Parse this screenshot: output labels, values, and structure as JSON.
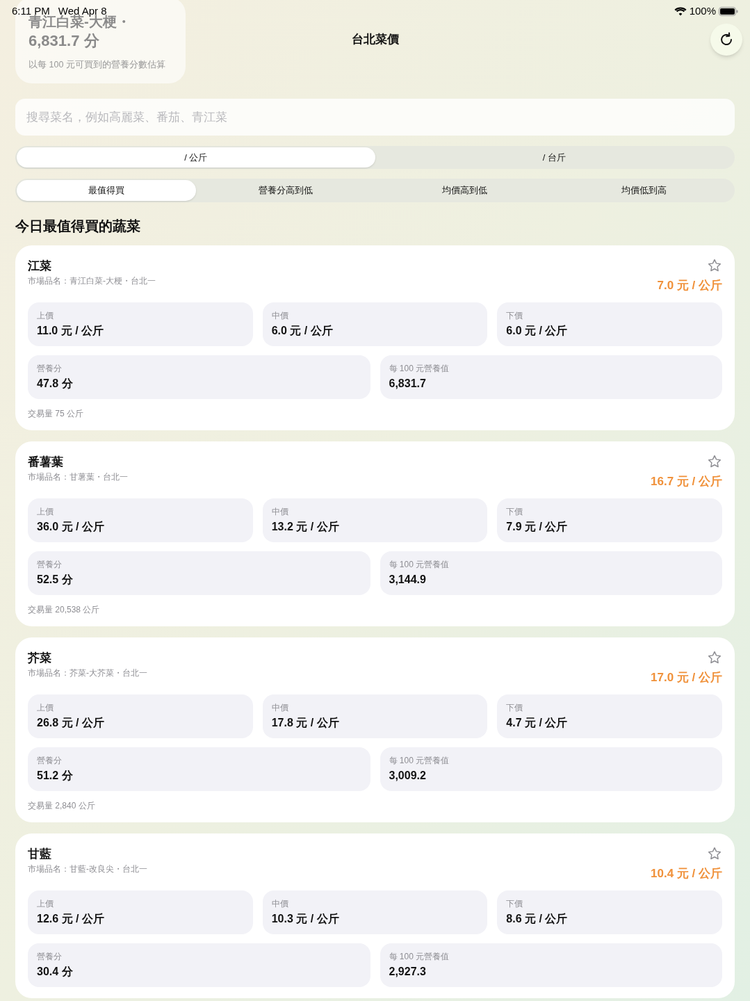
{
  "status_bar": {
    "time": "6:11 PM",
    "date": "Wed Apr 8",
    "battery": "100%"
  },
  "overlay_card": {
    "lines": [
      "青江白菜-大梗・",
      "6,831.7 分"
    ],
    "caption": "以每 100 元可買到的營養分數估算"
  },
  "header": {
    "title": "台北菜價"
  },
  "search": {
    "placeholder": "搜尋菜名，例如高麗菜、番茄、青江菜"
  },
  "unit_tabs": [
    {
      "label": "/ 公斤",
      "selected": true
    },
    {
      "label": "/ 台斤",
      "selected": false
    }
  ],
  "sort_tabs": [
    {
      "label": "最值得買",
      "selected": true
    },
    {
      "label": "營養分高到低",
      "selected": false
    },
    {
      "label": "均價高到低",
      "selected": false
    },
    {
      "label": "均價低到高",
      "selected": false
    }
  ],
  "section_title": "今日最值得買的蔬菜",
  "cards": [
    {
      "name": "江菜",
      "market": "市場品名：青江白菜-大梗・台北一",
      "favorite": false,
      "price": "7.0 元 / 公斤",
      "stats": [
        {
          "label": "上價",
          "value": "11.0 元 / 公斤"
        },
        {
          "label": "中價",
          "value": "6.0 元 / 公斤"
        },
        {
          "label": "下價",
          "value": "6.0 元 / 公斤"
        }
      ],
      "scores": [
        {
          "label": "營養分",
          "value": "47.8 分"
        },
        {
          "label": "每 100 元營養值",
          "value": "6,831.7"
        }
      ],
      "volume": "交易量 75 公斤"
    },
    {
      "name": "番薯葉",
      "market": "市場品名：甘薯葉・台北一",
      "favorite": false,
      "price": "16.7 元 / 公斤",
      "stats": [
        {
          "label": "上價",
          "value": "36.0 元 / 公斤"
        },
        {
          "label": "中價",
          "value": "13.2 元 / 公斤"
        },
        {
          "label": "下價",
          "value": "7.9 元 / 公斤"
        }
      ],
      "scores": [
        {
          "label": "營養分",
          "value": "52.5 分"
        },
        {
          "label": "每 100 元營養值",
          "value": "3,144.9"
        }
      ],
      "volume": "交易量 20,538 公斤"
    },
    {
      "name": "芥菜",
      "market": "市場品名：芥菜-大芥菜・台北一",
      "favorite": false,
      "price": "17.0 元 / 公斤",
      "stats": [
        {
          "label": "上價",
          "value": "26.8 元 / 公斤"
        },
        {
          "label": "中價",
          "value": "17.8 元 / 公斤"
        },
        {
          "label": "下價",
          "value": "4.7 元 / 公斤"
        }
      ],
      "scores": [
        {
          "label": "營養分",
          "value": "51.2 分"
        },
        {
          "label": "每 100 元營養值",
          "value": "3,009.2"
        }
      ],
      "volume": "交易量 2,840 公斤"
    },
    {
      "name": "甘藍",
      "market": "市場品名：甘藍-改良尖・台北一",
      "favorite": false,
      "price": "10.4 元 / 公斤",
      "stats": [
        {
          "label": "上價",
          "value": "12.6 元 / 公斤"
        },
        {
          "label": "中價",
          "value": "10.3 元 / 公斤"
        },
        {
          "label": "下價",
          "value": "8.6 元 / 公斤"
        }
      ],
      "scores": [
        {
          "label": "營養分",
          "value": "30.4 分"
        },
        {
          "label": "每 100 元營養值",
          "value": "2,927.3"
        }
      ]
    }
  ]
}
